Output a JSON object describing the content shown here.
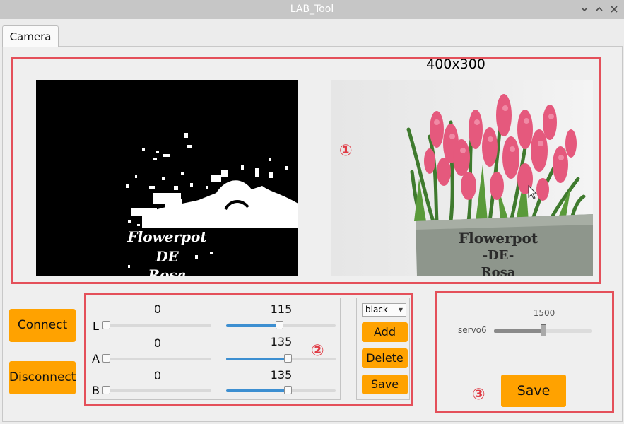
{
  "window": {
    "title": "LAB_Tool",
    "controls": [
      "chevron-down",
      "chevron-up",
      "close"
    ]
  },
  "tabs": [
    {
      "label": "Camera",
      "active": true
    }
  ],
  "preview": {
    "resolution": "400x300",
    "mask_text": [
      "Flowerpot",
      "DE",
      "Rosa"
    ],
    "pot_text": [
      "Flowerpot",
      "-DE-",
      "Rosa"
    ]
  },
  "annotations": {
    "one": "①",
    "two": "②",
    "three": "③",
    "color": "#e4505a"
  },
  "buttons": {
    "connect": "Connect",
    "disconnect": "Disconnect",
    "add": "Add",
    "delete": "Delete",
    "save_small": "Save",
    "save_large": "Save",
    "accent": "#ffa200"
  },
  "lab": {
    "sliders": [
      {
        "channel": "L",
        "min_value": "0",
        "max_value": "115",
        "min_level": 0,
        "max_level": 0.451
      },
      {
        "channel": "A",
        "min_value": "0",
        "max_value": "135",
        "min_level": 0,
        "max_level": 0.529
      },
      {
        "channel": "B",
        "min_value": "0",
        "max_value": "135",
        "min_level": 0,
        "max_level": 0.529
      }
    ],
    "color_select": "black",
    "slider_fill_color": "#3d8fd1"
  },
  "servo": {
    "name": "servo6",
    "value": "1500",
    "level": 0.5
  }
}
